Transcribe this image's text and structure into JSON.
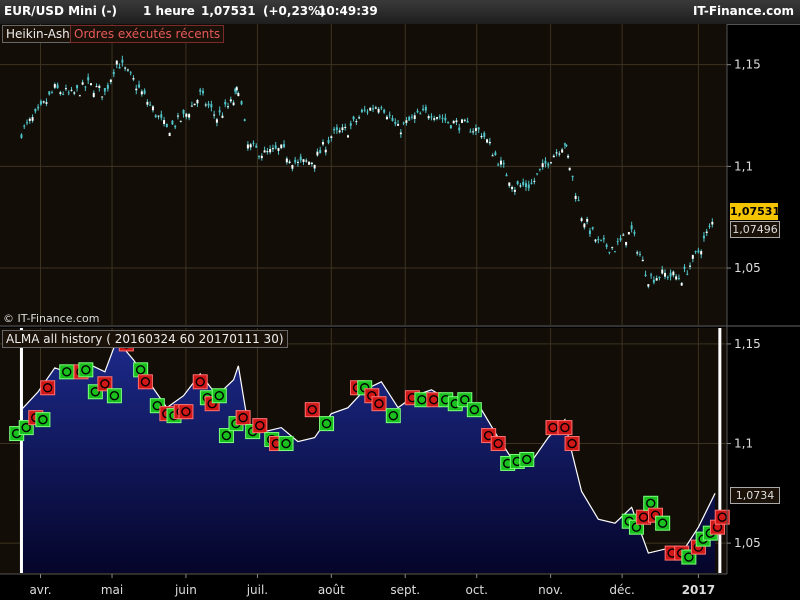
{
  "header": {
    "instrument": "EUR/USD Mini (-)",
    "timeframe": "1 heure",
    "price": "1,07531",
    "change": "(+0,23%)",
    "time": "10:49:39",
    "brand": "IT-Finance.com"
  },
  "labels": {
    "heikin": "Heikin-Ashi",
    "orders": "Ordres exécutés récents",
    "copyright": "© IT-Finance.com",
    "alma": "ALMA all history ( 20160324 60 20170111 30)"
  },
  "price_boxes": {
    "last": "1,07531",
    "second": "1,07496",
    "alma": "1,0734"
  },
  "colors": {
    "candle": "#4fc3c8",
    "area_top": "#1c2a8a",
    "area_bottom": "#05052a",
    "bg": "#120d06",
    "buy": "#19c01e",
    "sell": "#d01818"
  },
  "chart_data": [
    {
      "type": "line",
      "title": "Heikin-Ashi",
      "x_ticks": [
        "avr.",
        "mai",
        "juin",
        "juil.",
        "août",
        "sept.",
        "oct.",
        "nov.",
        "déc.",
        "2017"
      ],
      "y_ticks": [
        "1,15",
        "1,1",
        "1,05"
      ],
      "y_tick_values": [
        1.15,
        1.1,
        1.05
      ],
      "ylim": [
        1.022,
        1.17
      ],
      "grid": true,
      "last_price": 1.07531,
      "x": [
        "2016-03-24",
        "2016-03-31",
        "2016-04-07",
        "2016-04-14",
        "2016-04-21",
        "2016-04-28",
        "2016-05-03",
        "2016-05-10",
        "2016-05-17",
        "2016-05-24",
        "2016-05-31",
        "2016-06-07",
        "2016-06-14",
        "2016-06-21",
        "2016-06-23",
        "2016-06-27",
        "2016-07-04",
        "2016-07-11",
        "2016-07-18",
        "2016-07-25",
        "2016-08-01",
        "2016-08-08",
        "2016-08-15",
        "2016-08-22",
        "2016-08-29",
        "2016-09-05",
        "2016-09-12",
        "2016-09-19",
        "2016-09-26",
        "2016-10-03",
        "2016-10-10",
        "2016-10-17",
        "2016-10-24",
        "2016-10-31",
        "2016-11-07",
        "2016-11-09",
        "2016-11-14",
        "2016-11-21",
        "2016-11-28",
        "2016-12-05",
        "2016-12-12",
        "2016-12-19",
        "2016-12-26",
        "2017-01-02",
        "2017-01-09"
      ],
      "values": [
        1.117,
        1.126,
        1.138,
        1.135,
        1.14,
        1.136,
        1.152,
        1.142,
        1.13,
        1.118,
        1.124,
        1.135,
        1.124,
        1.132,
        1.139,
        1.11,
        1.106,
        1.108,
        1.101,
        1.103,
        1.115,
        1.118,
        1.127,
        1.131,
        1.118,
        1.124,
        1.127,
        1.122,
        1.12,
        1.117,
        1.103,
        1.09,
        1.091,
        1.103,
        1.112,
        1.1,
        1.076,
        1.062,
        1.06,
        1.068,
        1.045,
        1.047,
        1.045,
        1.058,
        1.075
      ]
    },
    {
      "type": "area",
      "title": "ALMA all history ( 20160324 60 20170111 30)",
      "x_ticks": [
        "avr.",
        "mai",
        "juin",
        "juil.",
        "août",
        "sept.",
        "oct.",
        "nov.",
        "déc.",
        "2017"
      ],
      "y_ticks": [
        "1,15",
        "1,1",
        "1,05"
      ],
      "y_tick_values": [
        1.15,
        1.1,
        1.05
      ],
      "ylim": [
        1.035,
        1.158
      ],
      "last_value": 1.0734,
      "x": [
        "2016-03-24",
        "2016-03-31",
        "2016-04-07",
        "2016-04-14",
        "2016-04-21",
        "2016-04-28",
        "2016-05-03",
        "2016-05-10",
        "2016-05-17",
        "2016-05-24",
        "2016-05-31",
        "2016-06-07",
        "2016-06-14",
        "2016-06-21",
        "2016-06-23",
        "2016-06-27",
        "2016-07-04",
        "2016-07-11",
        "2016-07-18",
        "2016-07-25",
        "2016-08-01",
        "2016-08-08",
        "2016-08-15",
        "2016-08-22",
        "2016-08-29",
        "2016-09-05",
        "2016-09-12",
        "2016-09-19",
        "2016-09-26",
        "2016-10-03",
        "2016-10-10",
        "2016-10-17",
        "2016-10-24",
        "2016-10-31",
        "2016-11-07",
        "2016-11-09",
        "2016-11-14",
        "2016-11-21",
        "2016-11-28",
        "2016-12-05",
        "2016-12-12",
        "2016-12-19",
        "2016-12-26",
        "2017-01-02",
        "2017-01-09"
      ],
      "values": [
        1.117,
        1.126,
        1.138,
        1.135,
        1.14,
        1.136,
        1.152,
        1.142,
        1.13,
        1.118,
        1.124,
        1.135,
        1.124,
        1.132,
        1.139,
        1.11,
        1.106,
        1.108,
        1.101,
        1.103,
        1.115,
        1.118,
        1.127,
        1.131,
        1.118,
        1.124,
        1.127,
        1.122,
        1.12,
        1.117,
        1.103,
        1.09,
        1.091,
        1.103,
        1.112,
        1.1,
        1.076,
        1.062,
        1.06,
        1.068,
        1.045,
        1.047,
        1.045,
        1.058,
        1.075
      ],
      "range_markers": [
        "2016-03-24",
        "2017-01-11"
      ],
      "trades": [
        {
          "date": "2016-03-22",
          "v": 1.105,
          "side": "buy"
        },
        {
          "date": "2016-03-26",
          "v": 1.108,
          "side": "buy"
        },
        {
          "date": "2016-03-30",
          "v": 1.113,
          "side": "sell"
        },
        {
          "date": "2016-04-02",
          "v": 1.112,
          "side": "buy"
        },
        {
          "date": "2016-04-04",
          "v": 1.128,
          "side": "sell"
        },
        {
          "date": "2016-04-12",
          "v": 1.136,
          "side": "buy"
        },
        {
          "date": "2016-04-18",
          "v": 1.136,
          "side": "sell"
        },
        {
          "date": "2016-04-20",
          "v": 1.137,
          "side": "buy"
        },
        {
          "date": "2016-04-24",
          "v": 1.126,
          "side": "buy"
        },
        {
          "date": "2016-04-28",
          "v": 1.13,
          "side": "sell"
        },
        {
          "date": "2016-05-02",
          "v": 1.124,
          "side": "buy"
        },
        {
          "date": "2016-05-07",
          "v": 1.15,
          "side": "sell"
        },
        {
          "date": "2016-05-13",
          "v": 1.137,
          "side": "buy"
        },
        {
          "date": "2016-05-15",
          "v": 1.131,
          "side": "sell"
        },
        {
          "date": "2016-05-20",
          "v": 1.119,
          "side": "buy"
        },
        {
          "date": "2016-05-24",
          "v": 1.115,
          "side": "sell"
        },
        {
          "date": "2016-05-27",
          "v": 1.114,
          "side": "buy"
        },
        {
          "date": "2016-05-30",
          "v": 1.116,
          "side": "sell"
        },
        {
          "date": "2016-06-01",
          "v": 1.116,
          "side": "sell"
        },
        {
          "date": "2016-06-07",
          "v": 1.131,
          "side": "sell"
        },
        {
          "date": "2016-06-10",
          "v": 1.123,
          "side": "buy"
        },
        {
          "date": "2016-06-12",
          "v": 1.12,
          "side": "sell"
        },
        {
          "date": "2016-06-15",
          "v": 1.124,
          "side": "buy"
        },
        {
          "date": "2016-06-18",
          "v": 1.104,
          "side": "buy"
        },
        {
          "date": "2016-06-22",
          "v": 1.11,
          "side": "buy"
        },
        {
          "date": "2016-06-25",
          "v": 1.113,
          "side": "sell"
        },
        {
          "date": "2016-06-29",
          "v": 1.106,
          "side": "buy"
        },
        {
          "date": "2016-07-02",
          "v": 1.109,
          "side": "sell"
        },
        {
          "date": "2016-07-07",
          "v": 1.102,
          "side": "buy"
        },
        {
          "date": "2016-07-09",
          "v": 1.1,
          "side": "sell"
        },
        {
          "date": "2016-07-13",
          "v": 1.1,
          "side": "buy"
        },
        {
          "date": "2016-07-24",
          "v": 1.117,
          "side": "sell"
        },
        {
          "date": "2016-07-30",
          "v": 1.11,
          "side": "buy"
        },
        {
          "date": "2016-08-12",
          "v": 1.128,
          "side": "sell"
        },
        {
          "date": "2016-08-15",
          "v": 1.128,
          "side": "buy"
        },
        {
          "date": "2016-08-18",
          "v": 1.124,
          "side": "sell"
        },
        {
          "date": "2016-08-21",
          "v": 1.12,
          "side": "sell"
        },
        {
          "date": "2016-08-27",
          "v": 1.114,
          "side": "buy"
        },
        {
          "date": "2016-09-04",
          "v": 1.123,
          "side": "sell"
        },
        {
          "date": "2016-09-08",
          "v": 1.122,
          "side": "buy"
        },
        {
          "date": "2016-09-13",
          "v": 1.122,
          "side": "sell"
        },
        {
          "date": "2016-09-18",
          "v": 1.122,
          "side": "buy"
        },
        {
          "date": "2016-09-22",
          "v": 1.12,
          "side": "buy"
        },
        {
          "date": "2016-09-26",
          "v": 1.122,
          "side": "buy"
        },
        {
          "date": "2016-09-30",
          "v": 1.117,
          "side": "buy"
        },
        {
          "date": "2016-10-06",
          "v": 1.104,
          "side": "sell"
        },
        {
          "date": "2016-10-10",
          "v": 1.1,
          "side": "sell"
        },
        {
          "date": "2016-10-14",
          "v": 1.09,
          "side": "buy"
        },
        {
          "date": "2016-10-18",
          "v": 1.091,
          "side": "buy"
        },
        {
          "date": "2016-10-22",
          "v": 1.092,
          "side": "buy"
        },
        {
          "date": "2016-11-02",
          "v": 1.108,
          "side": "sell"
        },
        {
          "date": "2016-11-07",
          "v": 1.108,
          "side": "sell"
        },
        {
          "date": "2016-11-10",
          "v": 1.1,
          "side": "sell"
        },
        {
          "date": "2016-12-04",
          "v": 1.061,
          "side": "buy"
        },
        {
          "date": "2016-12-07",
          "v": 1.058,
          "side": "buy"
        },
        {
          "date": "2016-12-10",
          "v": 1.063,
          "side": "sell"
        },
        {
          "date": "2016-12-13",
          "v": 1.07,
          "side": "buy"
        },
        {
          "date": "2016-12-15",
          "v": 1.064,
          "side": "sell"
        },
        {
          "date": "2016-12-18",
          "v": 1.06,
          "side": "buy"
        },
        {
          "date": "2016-12-22",
          "v": 1.045,
          "side": "sell"
        },
        {
          "date": "2016-12-26",
          "v": 1.045,
          "side": "sell"
        },
        {
          "date": "2016-12-29",
          "v": 1.043,
          "side": "buy"
        },
        {
          "date": "2017-01-02",
          "v": 1.048,
          "side": "sell"
        },
        {
          "date": "2017-01-04",
          "v": 1.052,
          "side": "buy"
        },
        {
          "date": "2017-01-07",
          "v": 1.055,
          "side": "buy"
        },
        {
          "date": "2017-01-10",
          "v": 1.058,
          "side": "sell"
        },
        {
          "date": "2017-01-12",
          "v": 1.063,
          "side": "sell"
        }
      ]
    }
  ]
}
